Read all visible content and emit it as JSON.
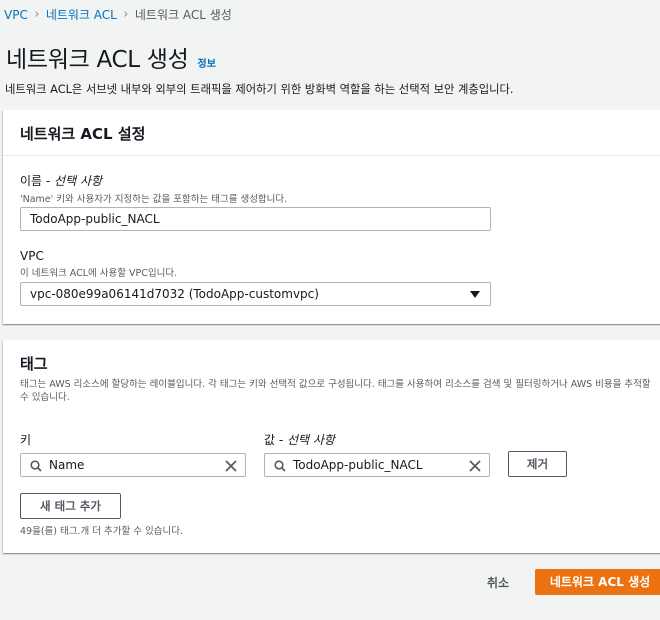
{
  "breadcrumb": {
    "items": [
      "VPC",
      "네트워크 ACL",
      "네트워크 ACL 생성"
    ]
  },
  "page": {
    "title": "네트워크 ACL 생성",
    "info_link": "정보",
    "description": "네트워크 ACL은 서브넷 내부와 외부의 트래픽을 제어하기 위한 방화벽 역할을 하는 선택적 보안 계층입니다."
  },
  "settings": {
    "heading": "네트워크 ACL 설정",
    "name_label": "이름 - ",
    "name_optional": "선택 사항",
    "name_desc": "'Name' 키와 사용자가 지정하는 값을 포함하는 태그를 생성합니다.",
    "name_value": "TodoApp-public_NACL",
    "vpc_label": "VPC",
    "vpc_desc": "이 네트워크 ACL에 사용할 VPC입니다.",
    "vpc_value": "vpc-080e99a06141d7032 (TodoApp-customvpc)"
  },
  "tags": {
    "heading": "태그",
    "description": "태그는 AWS 리소스에 할당하는 레이블입니다. 각 태그는 키와 선택적 값으로 구성됩니다. 태그를 사용하여 리소스를 검색 및 필터링하거나 AWS 비용을 추적할 수 있습니다.",
    "key_label": "키",
    "value_label": "값 - ",
    "value_optional": "선택 사항",
    "key_value": "Name",
    "value_value": "TodoApp-public_NACL",
    "remove_label": "제거",
    "add_label": "새 태그 추가",
    "limit_note": "49을(를) 태그.개 더 추가할 수 있습니다."
  },
  "footer": {
    "cancel_label": "취소",
    "create_label": "네트워크 ACL 생성"
  },
  "colors": {
    "link": "#0073bb",
    "primary": "#ec7211",
    "background": "#f2f3f3"
  }
}
